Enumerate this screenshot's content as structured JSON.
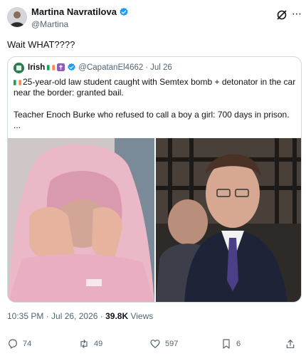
{
  "author": {
    "name": "Martina Navratilova",
    "handle": "@Martina"
  },
  "tweet": {
    "text": "Wait WHAT????"
  },
  "quote": {
    "name": "Irish",
    "handle": "@CapatanEl4662",
    "separator": "·",
    "date": "Jul 26",
    "line1": "25-year-old law student caught with Semtex bomb + detonator in the car",
    "line2": "near the border: granted bail.",
    "line3": "Teacher Enoch Burke who refused to call a boy a girl: 700 days in prison.",
    "line4": "..."
  },
  "meta": {
    "time": "10:35 PM · Jul 26, 2026 ·",
    "views_count": "39.8K",
    "views_label": "Views"
  },
  "actions": {
    "replies": "74",
    "reposts": "49",
    "likes": "597",
    "bookmarks": "6"
  },
  "colors": {
    "verified": "#1d9bf0",
    "text": "#0f1419",
    "muted": "#536471",
    "border": "#cfd9de"
  }
}
